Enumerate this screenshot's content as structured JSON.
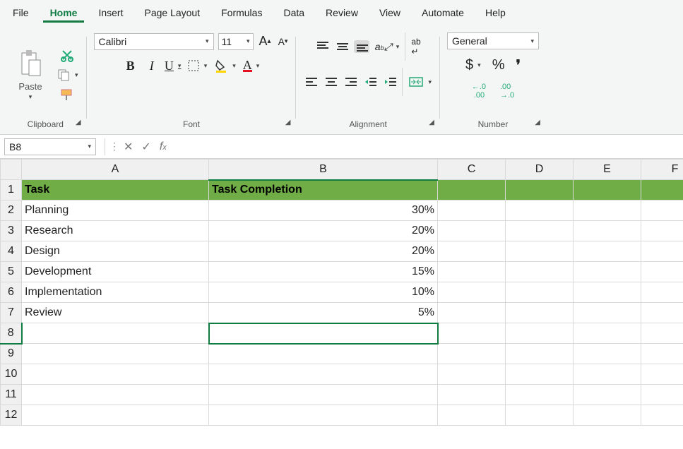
{
  "menu": {
    "file": "File",
    "home": "Home",
    "insert": "Insert",
    "page_layout": "Page Layout",
    "formulas": "Formulas",
    "data": "Data",
    "review": "Review",
    "view": "View",
    "automate": "Automate",
    "help": "Help"
  },
  "ribbon": {
    "clipboard": {
      "paste": "Paste",
      "label": "Clipboard"
    },
    "font": {
      "name": "Calibri",
      "size": "11",
      "label": "Font",
      "bold": "B",
      "italic": "I",
      "underline": "U",
      "grow": "A",
      "shrink": "A",
      "fill": "A",
      "color": "A"
    },
    "alignment": {
      "label": "Alignment",
      "wrap": "ab"
    },
    "number": {
      "format": "General",
      "label": "Number",
      "dollar": "$",
      "percent": "%",
      "comma": ",",
      "dec_inc": ".0",
      "dec_dec": ".00"
    }
  },
  "namebox": "B8",
  "formula_bar": "",
  "columns": [
    "A",
    "B",
    "C",
    "D",
    "E",
    "F"
  ],
  "rows": [
    "1",
    "2",
    "3",
    "4",
    "5",
    "6",
    "7",
    "8",
    "9",
    "10",
    "11",
    "12"
  ],
  "sheet": {
    "headers": {
      "task": "Task",
      "completion": "Task Completion"
    },
    "data": [
      {
        "task": "Planning",
        "pct": "30%"
      },
      {
        "task": "Research",
        "pct": "20%"
      },
      {
        "task": "Design",
        "pct": "20%"
      },
      {
        "task": "Development",
        "pct": "15%"
      },
      {
        "task": "Implementation",
        "pct": "10%"
      },
      {
        "task": "Review",
        "pct": "5%"
      }
    ]
  },
  "chart_data": {
    "type": "table",
    "title": "Task Completion",
    "categories": [
      "Planning",
      "Research",
      "Design",
      "Development",
      "Implementation",
      "Review"
    ],
    "values": [
      30,
      20,
      20,
      15,
      10,
      5
    ],
    "xlabel": "Task",
    "ylabel": "Task Completion (%)",
    "ylim": [
      0,
      100
    ]
  }
}
